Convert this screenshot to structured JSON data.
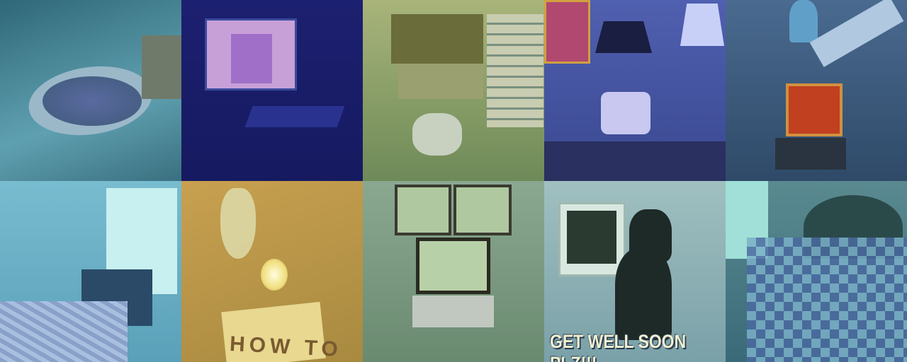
{
  "tiles": [
    {
      "subject": "pizza",
      "bg": "#3f7f8f"
    },
    {
      "subject": "projector-room",
      "bg": "#1b1f78"
    },
    {
      "subject": "laptop-drawers",
      "bg": "#8c9a62"
    },
    {
      "subject": "room-lamp-chair",
      "bg": "#4a58a8"
    },
    {
      "subject": "desk-laptop-feet",
      "bg": "#3b5f80"
    },
    {
      "subject": "bedroom",
      "bg": "#6ab4c8"
    },
    {
      "subject": "wine-candle",
      "bg": "#b89a4c"
    },
    {
      "subject": "three-laptops",
      "bg": "#7a9a7c"
    },
    {
      "subject": "black-cat",
      "bg": "#8ab0b0"
    },
    {
      "subject": "quilt-bed",
      "bg": "#4f7f88"
    }
  ],
  "texts": {
    "book_title": "HOW TO",
    "cat_caption": "GET WELL SOON PLZ!!!"
  }
}
